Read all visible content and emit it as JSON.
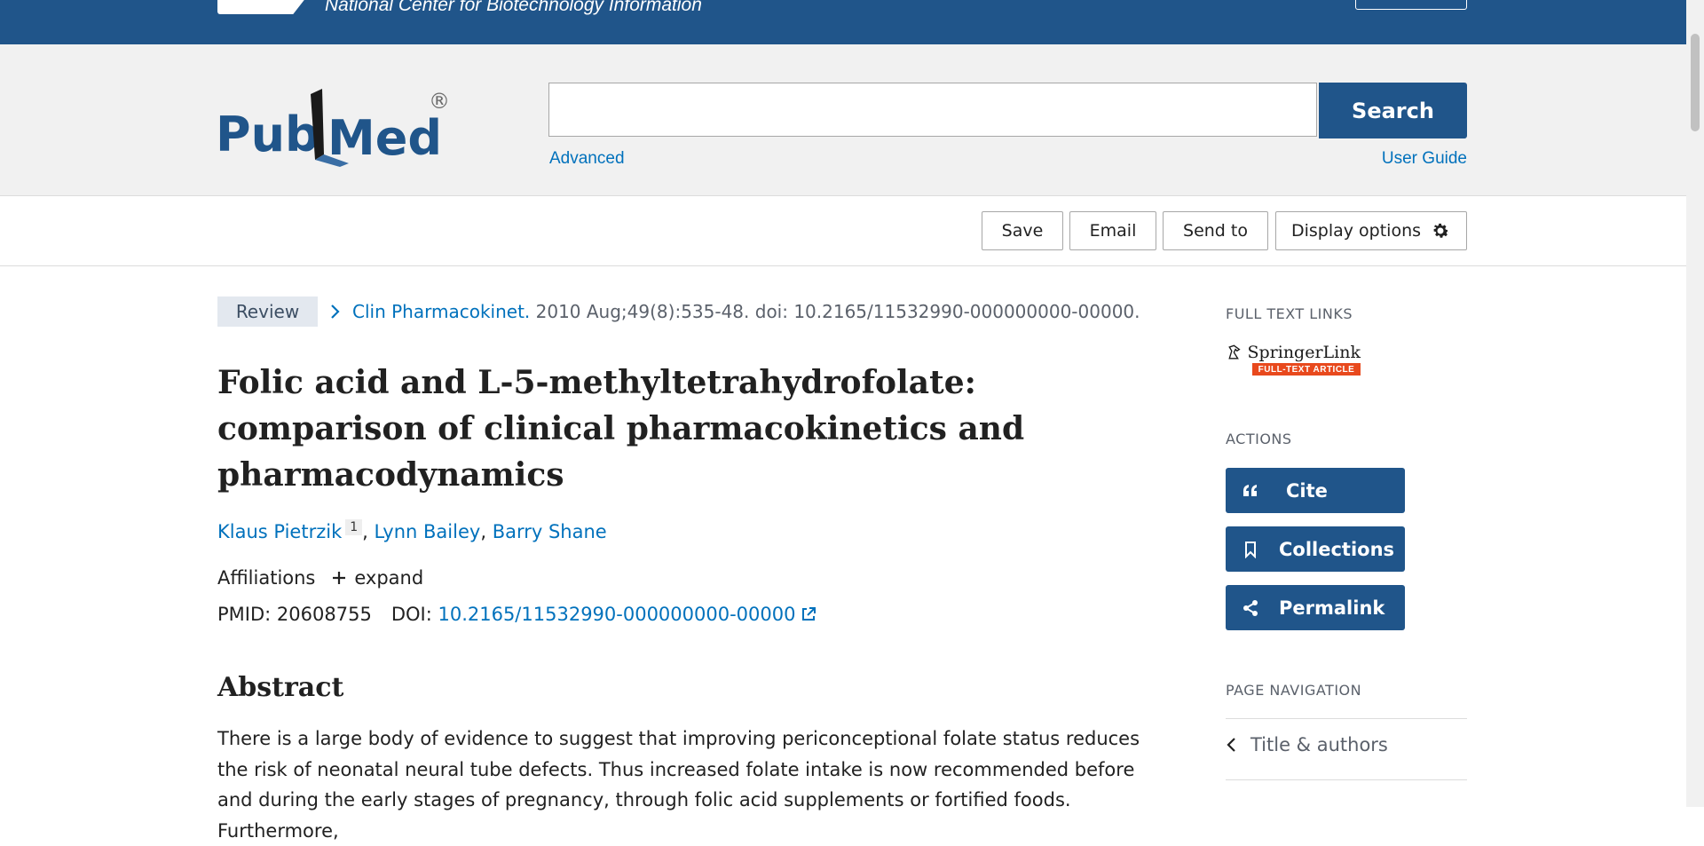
{
  "ncbi": {
    "name": "National Center for Biotechnology Information"
  },
  "header": {
    "logo_text": "PubMed",
    "registered": "®",
    "search_value": "",
    "search_placeholder": "",
    "search_button": "Search",
    "advanced": "Advanced",
    "user_guide": "User Guide"
  },
  "toolbar": {
    "save": "Save",
    "email": "Email",
    "send_to": "Send to",
    "display_options": "Display options"
  },
  "article": {
    "type_badge": "Review",
    "journal": "Clin Pharmacokinet.",
    "citation": " 2010 Aug;49(8):535-48. doi: 10.2165/11532990-000000000-00000.",
    "title": "Folic acid and L-5-methyltetrahydrofolate: comparison of clinical pharmacokinetics and pharmacodynamics",
    "authors": [
      {
        "name": "Klaus Pietrzik",
        "affil": "1"
      },
      {
        "name": "Lynn Bailey"
      },
      {
        "name": "Barry Shane"
      }
    ],
    "affiliations_label": "Affiliations",
    "expand_label": "expand",
    "pmid_label": "PMID:",
    "pmid": "20608755",
    "doi_label": "DOI:",
    "doi": "10.2165/11532990-000000000-00000",
    "abstract_heading": "Abstract",
    "abstract_text": "There is a large body of evidence to suggest that improving periconceptional folate status reduces the risk of neonatal neural tube defects. Thus increased folate intake is now recommended before and during the early stages of pregnancy, through folic acid supplements or fortified foods. Furthermore,"
  },
  "sidebar": {
    "full_text_heading": "FULL TEXT LINKS",
    "springer_top": "SpringerLink",
    "springer_bottom": "FULL-TEXT ARTICLE",
    "actions_heading": "ACTIONS",
    "cite": "Cite",
    "collections": "Collections",
    "permalink": "Permalink",
    "page_nav_heading": "PAGE NAVIGATION",
    "nav_title_authors": "Title & authors"
  },
  "colors": {
    "ncbi_blue": "#20558a",
    "link_blue": "#0071bc",
    "springer_orange": "#e8491d"
  }
}
